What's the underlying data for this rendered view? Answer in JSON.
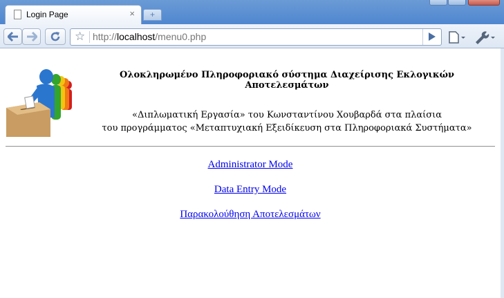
{
  "tab": {
    "title": "Login Page",
    "close": "×"
  },
  "newtab": {
    "label": "+"
  },
  "address": {
    "scheme": "http://",
    "host": "localhost",
    "path": "/menu0.php"
  },
  "page": {
    "heading": "Ολοκληρωμένο Πληροφοριακό σύστημα Διαχείρισης Εκλογικών Αποτελεσμάτων",
    "subtitle_line1": "«Διπλωματική Εργασία» του Κωνσταντίνου Χουβαρδά στα πλαίσια",
    "subtitle_line2": "του προγράμματος «Μεταπτυχιακή Εξειδίκευση στα Πληροφοριακά Συστήματα»"
  },
  "menu": [
    {
      "label": "Administrator Mode"
    },
    {
      "label": "Data Entry Mode"
    },
    {
      "label": "Παρακολούθηση Αποτελεσμάτων"
    }
  ],
  "icons": {
    "back": "back-arrow-icon",
    "forward": "forward-arrow-icon",
    "reload": "reload-icon",
    "bookmark": "star-icon",
    "go": "go-arrow-icon",
    "page_menu": "page-menu-icon",
    "tools_menu": "wrench-icon"
  }
}
